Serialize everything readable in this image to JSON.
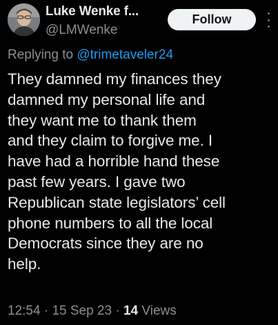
{
  "author": {
    "name": "Luke Wenke f...",
    "handle": "@LMWenke",
    "avatar": "profile-photo"
  },
  "follow_button": {
    "label": "Follow"
  },
  "more_menu": {
    "icon": "more-vertical-icon"
  },
  "reply_context": {
    "prefix": "Replying to",
    "mention": "@trimetaveler24"
  },
  "tweet": {
    "lines": [
      "They damned my finances they",
      "damned my personal life and",
      "they want me to thank them",
      "and they claim to forgive me.  I",
      "have had a horrible hand these",
      "past few years.  I gave two",
      "Republican state legislators’ cell",
      "phone numbers to all the local",
      "Democrats since they are no",
      "help."
    ]
  },
  "meta": {
    "time": "12:54",
    "date": "15 Sep 23",
    "views_count": "14",
    "views_label": "Views",
    "separator": "·"
  },
  "colors": {
    "background": "#000000",
    "text_primary": "#e7e9ea",
    "text_secondary": "#8b8f94",
    "link": "#1d9bf0",
    "follow_bg": "#eff3f4"
  }
}
